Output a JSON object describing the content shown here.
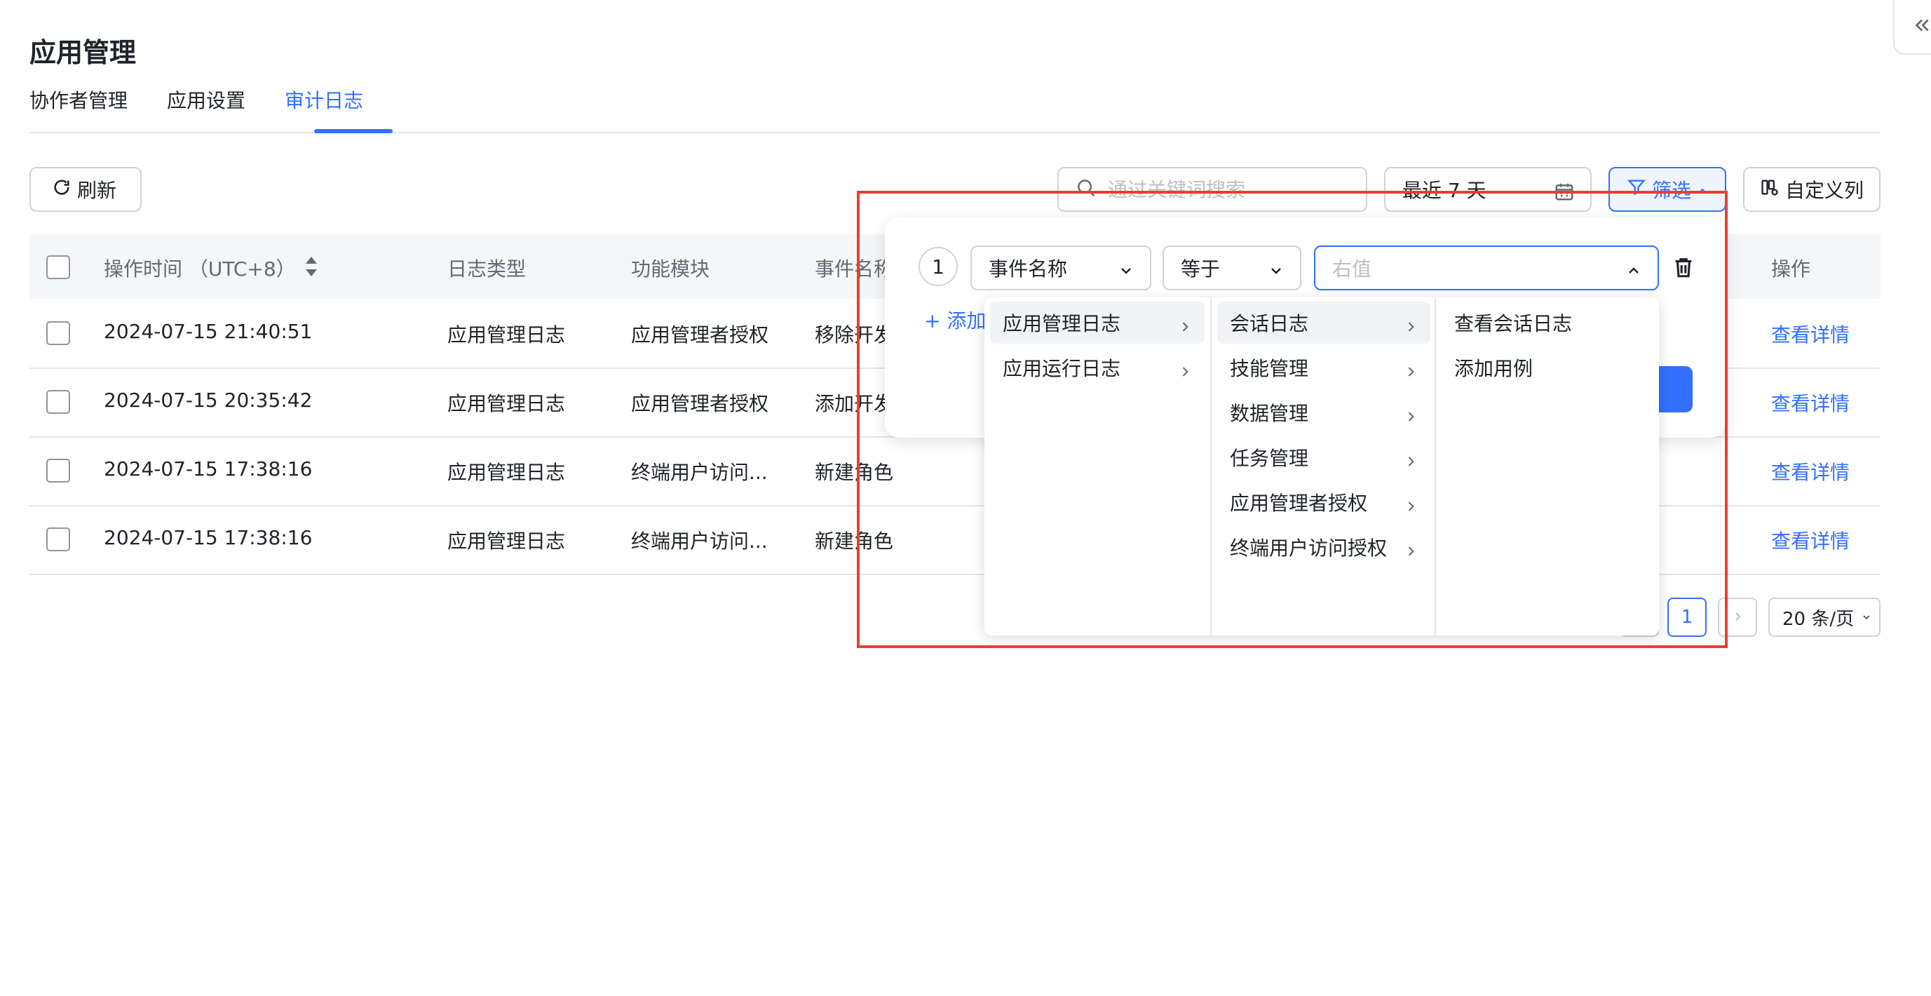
{
  "page": {
    "title": "应用管理"
  },
  "tabs": [
    {
      "label": "协作者管理"
    },
    {
      "label": "应用设置"
    },
    {
      "label": "审计日志",
      "active": true
    }
  ],
  "toolbar": {
    "refresh_label": "刷新",
    "search_placeholder": "通过关键词搜索",
    "date_range": "最近 7 天",
    "filter_label": "筛选",
    "custom_columns_label": "自定义列"
  },
  "table": {
    "columns": [
      "操作时间 （UTC+8）",
      "日志类型",
      "功能模块",
      "事件名称",
      "操作"
    ],
    "rows": [
      {
        "time": "2024-07-15 21:40:51",
        "type": "应用管理日志",
        "module": "应用管理者授权",
        "event": "移除开发",
        "action": "查看详情"
      },
      {
        "time": "2024-07-15 20:35:42",
        "type": "应用管理日志",
        "module": "应用管理者授权",
        "event": "添加开发",
        "action": "查看详情"
      },
      {
        "time": "2024-07-15 17:38:16",
        "type": "应用管理日志",
        "module": "终端用户访问...",
        "event": "新建角色",
        "action": "查看详情"
      },
      {
        "time": "2024-07-15 17:38:16",
        "type": "应用管理日志",
        "module": "终端用户访问...",
        "event": "新建角色",
        "action": "查看详情"
      }
    ]
  },
  "pagination": {
    "current_page": "1",
    "page_size": "20 条/页"
  },
  "filter_panel": {
    "index": "1",
    "field": "事件名称",
    "operator": "等于",
    "value_placeholder": "右值",
    "add_condition": "添加"
  },
  "cascader": {
    "level1": [
      "应用管理日志",
      "应用运行日志"
    ],
    "level2": [
      "会话日志",
      "技能管理",
      "数据管理",
      "任务管理",
      "应用管理者授权",
      "终端用户访问授权"
    ],
    "level3": [
      "查看会话日志",
      "添加用例"
    ],
    "active_level1": "应用管理日志",
    "active_level2": "会话日志"
  },
  "colors": {
    "accent": "#3370ff",
    "highlight_box": "#e5412f",
    "border": "#d0d3d6"
  },
  "icons": [
    "refresh-icon",
    "search-icon",
    "calendar-icon",
    "filter-icon",
    "columns-icon",
    "sort-icon",
    "chevron-down-icon",
    "chevron-up-icon",
    "chevron-right-icon",
    "trash-icon",
    "plus-icon",
    "collapse-left-icon"
  ]
}
